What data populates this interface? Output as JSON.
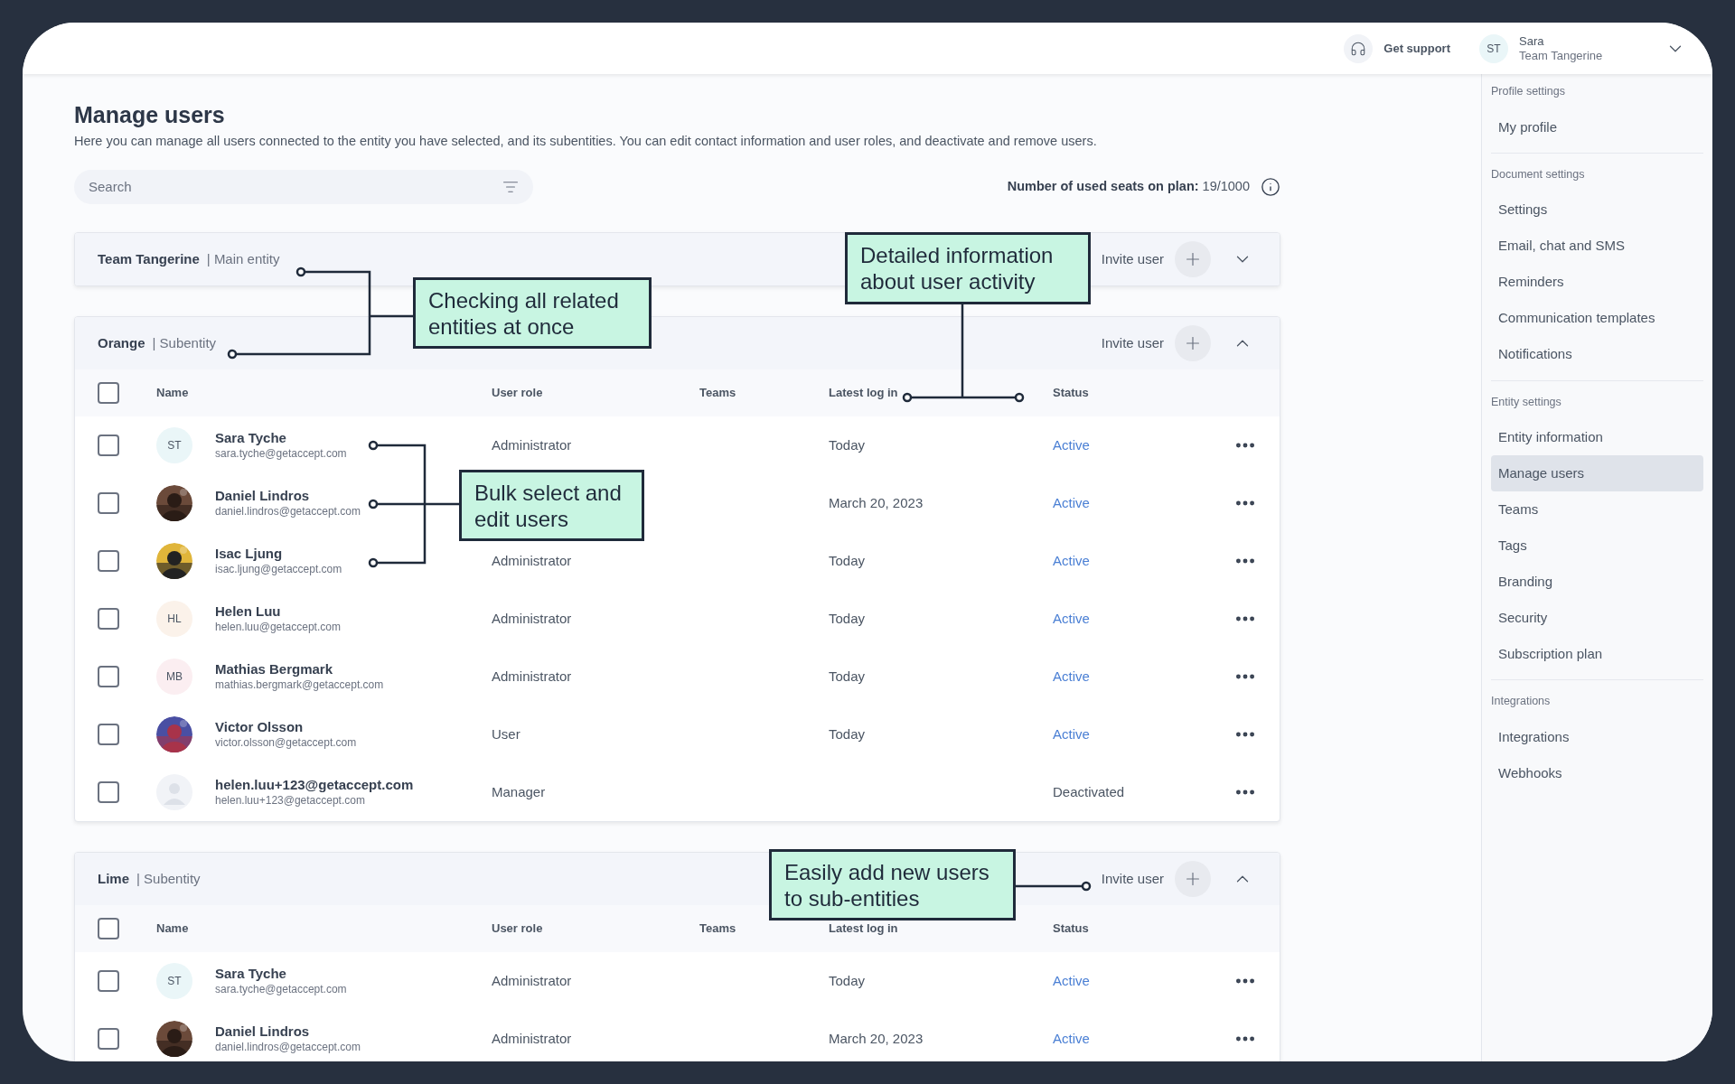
{
  "header": {
    "support": "Get support",
    "user": {
      "initials": "ST",
      "name": "Sara",
      "team": "Team Tangerine"
    }
  },
  "page": {
    "title": "Manage users",
    "description": "Here you can manage all users connected to the entity you have selected, and its subentities. You can edit contact information and user roles, and deactivate and remove users.",
    "search": {
      "placeholder": "Search"
    },
    "seats": {
      "label": "Number of used seats on plan:",
      "value": "19/1000"
    }
  },
  "entities": [
    {
      "name": "Team Tangerine",
      "type": "| Main entity",
      "expanded": false,
      "invite": "Invite user"
    },
    {
      "name": "Orange",
      "type": "| Subentity",
      "expanded": true,
      "all_checked": false,
      "invite": "Invite user",
      "columns": [
        "Name",
        "User role",
        "Teams",
        "Latest log in",
        "Status"
      ],
      "rows": [
        {
          "checked": false,
          "avatar": {
            "kind": "initials",
            "initials": "ST",
            "color": "#eaf6f8"
          },
          "name": "Sara Tyche",
          "email": "sara.tyche@getaccept.com",
          "role": "Administrator",
          "last_login": "Today",
          "status": "Active",
          "active": true
        },
        {
          "checked": false,
          "name": "Daniel Lindros",
          "email": "daniel.lindros@getaccept.com",
          "last_login": "March 20, 2023",
          "status": "Active",
          "active": true
        },
        {
          "checked": false,
          "name": "Isac Ljung",
          "email": "isac.ljung@getaccept.com",
          "role": "Administrator",
          "last_login": "Today",
          "status": "Active",
          "active": true
        },
        {
          "checked": false,
          "avatar": {
            "kind": "initials",
            "initials": "HL",
            "color": "#fbf2ea"
          },
          "name": "Helen Luu",
          "email": "helen.luu@getaccept.com",
          "role": "Administrator",
          "last_login": "Today",
          "status": "Active",
          "active": true
        },
        {
          "checked": false,
          "avatar": {
            "kind": "initials",
            "initials": "MB",
            "color": "#fbeef1"
          },
          "name": "Mathias Bergmark",
          "email": "mathias.bergmark@getaccept.com",
          "role": "Administrator",
          "last_login": "Today",
          "status": "Active",
          "active": true
        },
        {
          "checked": false,
          "name": "Victor Olsson",
          "email": "victor.olsson@getaccept.com",
          "role": "User",
          "last_login": "Today",
          "status": "Active",
          "active": true
        },
        {
          "checked": false,
          "avatar": {
            "kind": "placeholder"
          },
          "name": "helen.luu+123@getaccept.com",
          "email": "helen.luu+123@getaccept.com",
          "role": "Manager",
          "status": "Deactivated",
          "active": false
        }
      ]
    },
    {
      "name": "Lime",
      "type": "| Subentity",
      "expanded": true,
      "all_checked": false,
      "invite": "Invite user",
      "columns": [
        "Name",
        "User role",
        "Teams",
        "Latest log in",
        "Status"
      ],
      "rows": [
        {
          "checked": false,
          "avatar": {
            "kind": "initials",
            "initials": "ST",
            "color": "#eaf6f8"
          },
          "name": "Sara Tyche",
          "email": "sara.tyche@getaccept.com",
          "role": "Administrator",
          "last_login": "Today",
          "status": "Active",
          "active": true
        },
        {
          "checked": false,
          "name": "Daniel Lindros",
          "email": "daniel.lindros@getaccept.com",
          "role": "Administrator",
          "last_login": "March 20, 2023",
          "status": "Active",
          "active": true
        }
      ]
    }
  ],
  "sidebar": {
    "sections": [
      {
        "title": "Profile settings",
        "items": [
          {
            "label": "My profile",
            "selected": false
          }
        ]
      },
      {
        "title": "Document settings",
        "items": [
          {
            "label": "Settings",
            "selected": false
          },
          {
            "label": "Email, chat and SMS",
            "selected": false
          },
          {
            "label": "Reminders",
            "selected": false
          },
          {
            "label": "Communication templates",
            "selected": false
          },
          {
            "label": "Notifications",
            "selected": false
          }
        ]
      },
      {
        "title": "Entity settings",
        "items": [
          {
            "label": "Entity information",
            "selected": false
          },
          {
            "label": "Manage users",
            "selected": true
          },
          {
            "label": "Teams",
            "selected": false
          },
          {
            "label": "Tags",
            "selected": false
          },
          {
            "label": "Branding",
            "selected": false
          },
          {
            "label": "Security",
            "selected": false
          },
          {
            "label": "Subscription plan",
            "selected": false
          }
        ]
      },
      {
        "title": "Integrations",
        "items": [
          {
            "label": "Integrations",
            "selected": false
          },
          {
            "label": "Webhooks",
            "selected": false
          }
        ]
      }
    ]
  },
  "annotations": [
    {
      "text": "Checking all related entities at once"
    },
    {
      "text": "Detailed information about user activity"
    },
    {
      "text": "Bulk select and edit users"
    },
    {
      "text": "Easily add new users to sub-entities"
    }
  ]
}
